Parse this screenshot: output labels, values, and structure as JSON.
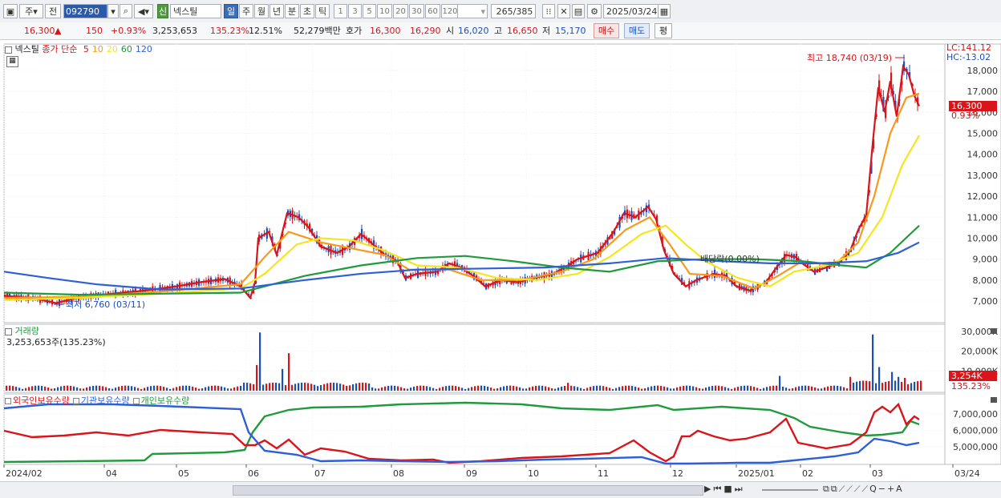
{
  "toolbar": {
    "market_label": "주",
    "prev_label": "전",
    "stock_code": "092790",
    "credit_badge": "신",
    "stock_name": "넥스틸",
    "period_tabs": [
      "일",
      "주",
      "월",
      "년",
      "분",
      "초",
      "틱"
    ],
    "active_period": "일",
    "interval_buttons": [
      "1",
      "3",
      "5",
      "10",
      "20",
      "30",
      "60",
      "120"
    ],
    "count_display": "265/385",
    "date": "2025/03/24"
  },
  "quote": {
    "price": "16,300",
    "arrow": "▲",
    "change": "150",
    "change_pct": "+0.93%",
    "volume": "3,253,653",
    "volume_ratio": "135.23%",
    "turnover": "12.51%",
    "amount": "52,279백만",
    "ask_label": "호가",
    "ask": "16,300",
    "bid": "16,290",
    "open_label": "시",
    "open": "16,020",
    "high_label": "고",
    "high": "16,650",
    "low_label": "저",
    "low": "15,170",
    "buy_button": "매수",
    "sell_button": "매도",
    "eval_button": "평"
  },
  "price_panel": {
    "legend_stock": "넥스틸",
    "legend_ma_label": "종가 단순",
    "ma_periods": [
      {
        "period": "5",
        "color": "#d9141a"
      },
      {
        "period": "10",
        "color": "#f59a1c"
      },
      {
        "period": "20",
        "color": "#f5e51c"
      },
      {
        "period": "60",
        "color": "#1f9a3c"
      },
      {
        "period": "120",
        "color": "#2f5fd8"
      }
    ],
    "lc_label": "LC:141.12",
    "hc_label": "HC:-13.02",
    "y_axis_labels": [
      "18,000",
      "17,000",
      "16,000",
      "15,000",
      "14,000",
      "13,000",
      "12,000",
      "11,000",
      "10,000",
      "9,000",
      "8,000",
      "7,000"
    ],
    "current_price_tag": "16,300",
    "current_pct": "0.93%",
    "high_annotation": "최고 18,740 (03/19)",
    "low_annotation": "최저 6,760 (03/11)",
    "allocation_annotation": "배당락(0.00%)"
  },
  "volume_panel": {
    "title": "거래량",
    "subtitle": "3,253,653주(135.23%)",
    "y_axis_labels": [
      "30,000K",
      "20,000K",
      "10,000K"
    ],
    "current_tag": "3,254K",
    "current_pct": "135.23%"
  },
  "holdings_panel": {
    "legend": [
      {
        "label": "외국인보유수량",
        "color": "#d9141a"
      },
      {
        "label": "기관보유수량",
        "color": "#2f5fd8"
      },
      {
        "label": "개인보유수량",
        "color": "#1f9a3c"
      }
    ],
    "y_axis_labels": [
      "7,000,000",
      "6,000,000",
      "5,000,000"
    ]
  },
  "x_axis": {
    "labels": [
      "2024/02",
      "04",
      "05",
      "06",
      "07",
      "08",
      "09",
      "10",
      "11",
      "12",
      "2025/01",
      "02",
      "03",
      "03/24"
    ]
  },
  "colors": {
    "up": "#d9141a",
    "down": "#1a4fbf",
    "accent": "#3d6fb8"
  }
}
